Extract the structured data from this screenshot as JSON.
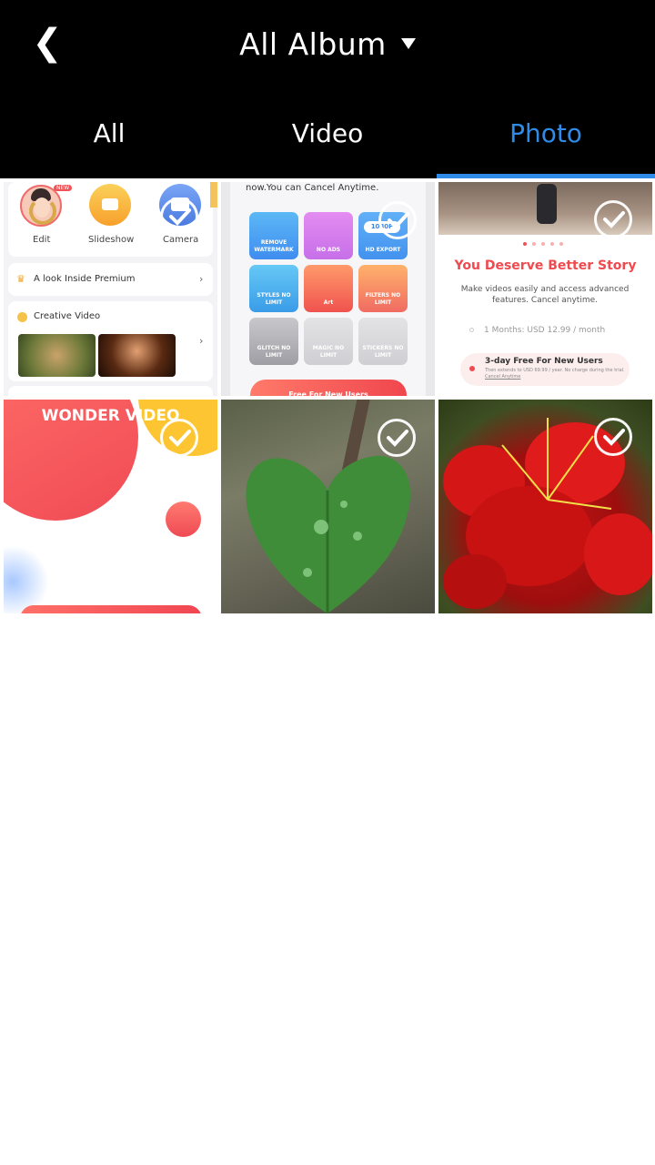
{
  "header": {
    "back_glyph": "❮",
    "title": "All Album",
    "dropdown_icon": "caret-down-icon"
  },
  "tabs": [
    {
      "label": "All",
      "active": false
    },
    {
      "label": "Video",
      "active": false
    },
    {
      "label": "Photo",
      "active": true
    }
  ],
  "colors": {
    "header_bg": "#000000",
    "active_tab": "#2f8be8",
    "accent_red": "#f05256"
  },
  "grid": {
    "tiles": [
      {
        "kind": "app-screenshot",
        "labels": {
          "edit": "Edit",
          "slideshow": "Slideshow",
          "camera": "Camera",
          "new_badge": "NEW",
          "premium": "A look Inside Premium",
          "creative": "Creative Video"
        }
      },
      {
        "kind": "app-screenshot",
        "labels": {
          "top": "now.You can Cancel Anytime.",
          "remove": "REMOVE WATERMARK",
          "noads": "NO ADS",
          "hd": "HD EXPORT",
          "hd_badge": "1080P",
          "styles": "STYLES NO LIMIT",
          "art": "Art",
          "filters": "FILTERS NO LIMIT",
          "glitch": "GLITCH NO LIMIT",
          "magic": "MAGIC NO LIMIT",
          "stickers": "STICKERS NO LIMIT",
          "cta": "Free For New Users"
        }
      },
      {
        "kind": "app-screenshot",
        "labels": {
          "headline": "You Deserve Better Story",
          "body": "Make videos easily and access advanced features. Cancel anytime.",
          "plan": "1 Months: USD 12.99 / month",
          "trial": "3-day Free For New Users",
          "trial_sub": "Then extends to USD 69.99 / year. No charge during the trial.",
          "trial_link": "Cancel Anytime"
        }
      },
      {
        "kind": "app-screenshot",
        "labels": {
          "banner": "WONDER VIDEO"
        }
      },
      {
        "kind": "photo",
        "subject": "heart-shaped green leaf with water drops"
      },
      {
        "kind": "photo",
        "subject": "red flowers with water drops"
      }
    ]
  }
}
